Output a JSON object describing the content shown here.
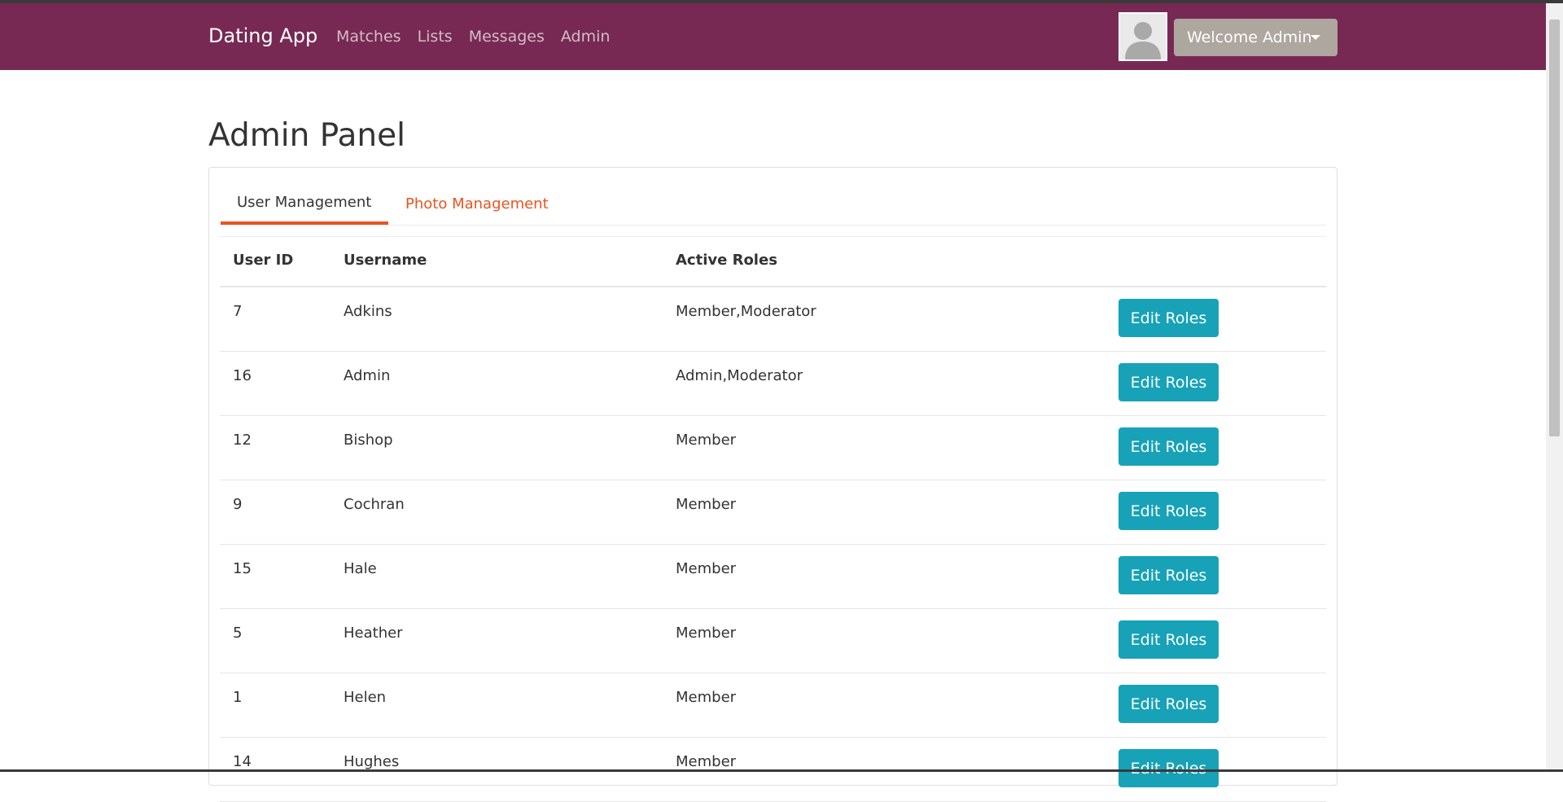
{
  "navbar": {
    "brand": "Dating App",
    "links": [
      "Matches",
      "Lists",
      "Messages",
      "Admin"
    ],
    "user_menu_label": "Welcome Admin",
    "color": "#772953"
  },
  "page": {
    "title": "Admin Panel"
  },
  "tabs": [
    {
      "label": "User Management",
      "active": true
    },
    {
      "label": "Photo Management",
      "active": false
    }
  ],
  "table": {
    "headers": [
      "User ID",
      "Username",
      "Active Roles"
    ],
    "action_label": "Edit Roles",
    "rows": [
      {
        "id": "7",
        "username": "Adkins",
        "roles": "Member,Moderator"
      },
      {
        "id": "16",
        "username": "Admin",
        "roles": "Admin,Moderator"
      },
      {
        "id": "12",
        "username": "Bishop",
        "roles": "Member"
      },
      {
        "id": "9",
        "username": "Cochran",
        "roles": "Member"
      },
      {
        "id": "15",
        "username": "Hale",
        "roles": "Member"
      },
      {
        "id": "5",
        "username": "Heather",
        "roles": "Member"
      },
      {
        "id": "1",
        "username": "Helen",
        "roles": "Member"
      },
      {
        "id": "14",
        "username": "Hughes",
        "roles": "Member"
      }
    ]
  },
  "icons": {
    "avatar": "user-avatar-icon",
    "dropdown": "caret-down-icon"
  },
  "colors": {
    "accent": "#e95420",
    "button": "#17a2b8",
    "user_menu": "#aea79f"
  }
}
